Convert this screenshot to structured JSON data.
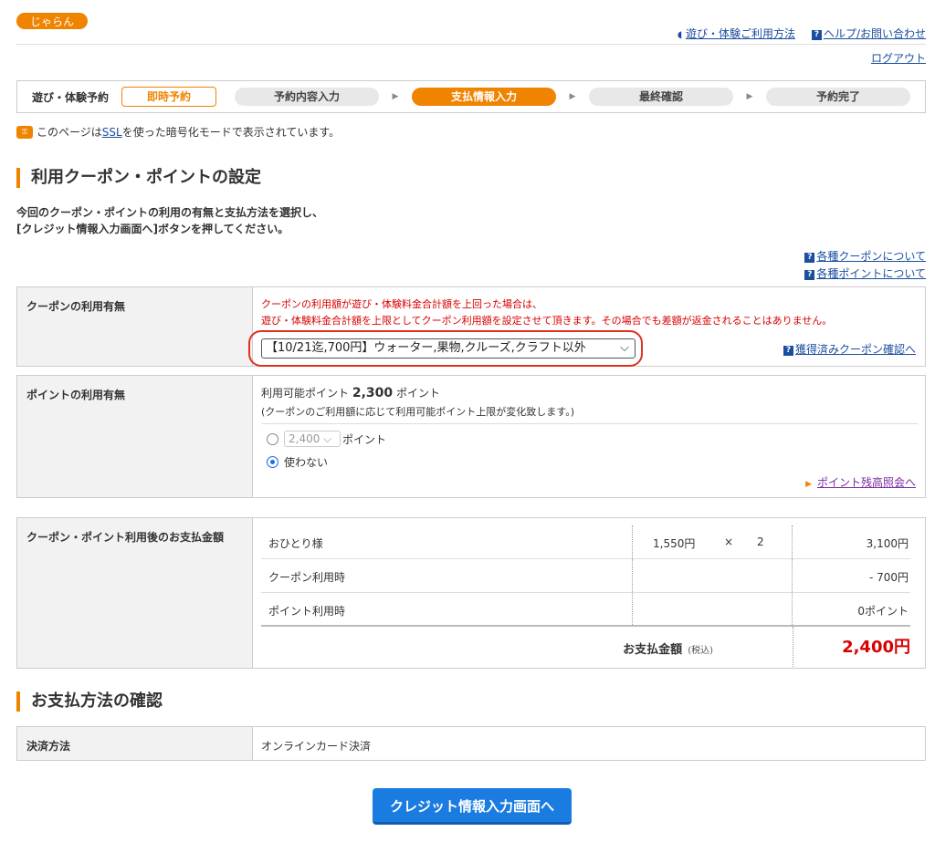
{
  "header": {
    "logo_text": "じゃらん",
    "links": [
      "遊び・体験ご利用方法",
      "ヘルプ/お問い合わせ"
    ],
    "logout": "ログアウト"
  },
  "steps": {
    "title": "遊び・体験予約",
    "badge": "即時予約",
    "items": [
      "予約内容入力",
      "支払情報入力",
      "最終確認",
      "予約完了"
    ],
    "active_index": 1
  },
  "ssl": {
    "pre": "このページは",
    "link": "SSL",
    "post": "を使った暗号化モードで表示されています。"
  },
  "section1": {
    "title": "利用クーポン・ポイントの設定",
    "intro1": "今回のクーポン・ポイントの利用の有無と支払方法を選択し、",
    "intro2": "[クレジット情報入力画面へ]ボタンを押してください。",
    "about_coupon": "各種クーポンについて",
    "about_point": "各種ポイントについて"
  },
  "coupon": {
    "label": "クーポンの利用有無",
    "warn1": "クーポンの利用額が遊び・体験料金合計額を上回った場合は、",
    "warn2": "遊び・体験料金合計額を上限としてクーポン利用額を設定させて頂きます。その場合でも差額が返金されることはありません。",
    "selected": "【10/21迄,700円】ウォーター,果物,クルーズ,クラフト以外",
    "link": "獲得済みクーポン確認へ"
  },
  "points": {
    "label": "ポイントの利用有無",
    "avail_pre": "利用可能ポイント",
    "avail_value": "2,300",
    "avail_unit": "ポイント",
    "note": "(クーポンのご利用額に応じて利用可能ポイント上限が変化致します。)",
    "option_value": "2,400",
    "option_unit": "ポイント",
    "option_none": "使わない",
    "link": "ポイント残高照会へ"
  },
  "payment_calc": {
    "label": "クーポン・ポイント利用後のお支払金額",
    "row1": {
      "label": "おひとり様",
      "unit_price": "1,550円",
      "times": "×",
      "qty": "2",
      "amount": "3,100円"
    },
    "row2": {
      "label": "クーポン利用時",
      "amount": "- 700円"
    },
    "row3": {
      "label": "ポイント利用時",
      "amount": "0ポイント"
    },
    "total_label": "お支払金額",
    "tax_note": "(税込)",
    "total_value": "2,400円"
  },
  "section2": {
    "title": "お支払方法の確認",
    "method_label": "決済方法",
    "method_value": "オンラインカード決済"
  },
  "submit_label": "クレジット情報入力画面へ",
  "colors": {
    "accent": "#f08300",
    "link": "#1a4fa0",
    "warn": "#d80000",
    "button": "#1a7be0"
  }
}
